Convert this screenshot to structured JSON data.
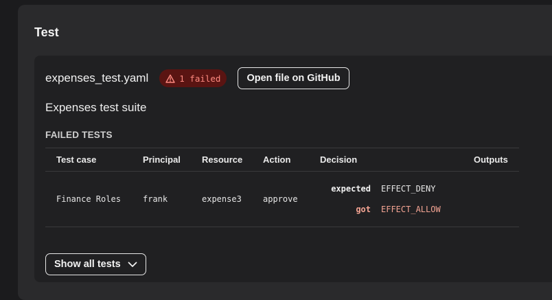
{
  "section": {
    "title": "Test"
  },
  "file": {
    "name": "expenses_test.yaml",
    "failed_badge": "1 failed",
    "github_button": "Open file on GitHub"
  },
  "suite": {
    "description": "Expenses test suite"
  },
  "failed_tests": {
    "heading": "FAILED TESTS",
    "columns": [
      "Test case",
      "Principal",
      "Resource",
      "Action",
      "Decision",
      "Outputs"
    ],
    "rows": [
      {
        "test_case": "Finance Roles",
        "principal": "frank",
        "resource": "expense3",
        "action": "approve",
        "decision": {
          "expected_label": "expected",
          "expected_value": "EFFECT_DENY",
          "got_label": "got",
          "got_value": "EFFECT_ALLOW"
        },
        "outputs": ""
      }
    ]
  },
  "show_all_button": "Show all tests",
  "icons": {
    "badge": "warning-triangle-icon",
    "show_all": "chevron-down-icon"
  },
  "colors": {
    "badge_bg": "#5a1412",
    "badge_text": "#ff8a80",
    "got_text": "#f4a493"
  }
}
